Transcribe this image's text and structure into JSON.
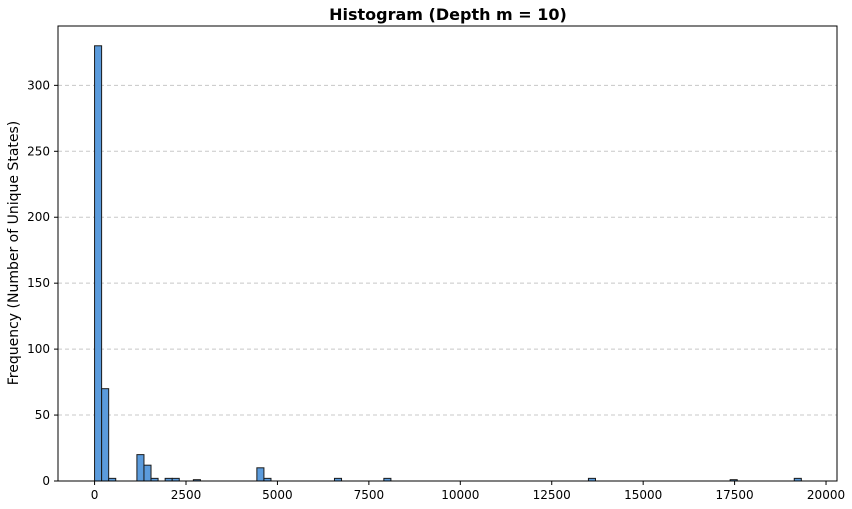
{
  "chart_data": {
    "type": "bar",
    "title": "Histogram  (Depth m = 10)",
    "xlabel": "",
    "ylabel": "Frequency (Number of Unique States)",
    "xlim": [
      -1000,
      20300
    ],
    "ylim": [
      0,
      345
    ],
    "bin_width": 193,
    "x_ticks": [
      0,
      2500,
      5000,
      7500,
      10000,
      12500,
      15000,
      17500,
      20000
    ],
    "y_ticks": [
      0,
      50,
      100,
      150,
      200,
      250,
      300
    ],
    "grid": "y dashed",
    "bar_color": "#5b9bdc",
    "edge_color": "#1a1a1a",
    "bins": [
      {
        "x": 96,
        "count": 330
      },
      {
        "x": 289,
        "count": 70
      },
      {
        "x": 482,
        "count": 2
      },
      {
        "x": 1254,
        "count": 20
      },
      {
        "x": 1447,
        "count": 12
      },
      {
        "x": 1640,
        "count": 2
      },
      {
        "x": 2026,
        "count": 2
      },
      {
        "x": 2219,
        "count": 2
      },
      {
        "x": 2798,
        "count": 1
      },
      {
        "x": 4534,
        "count": 10
      },
      {
        "x": 4727,
        "count": 2
      },
      {
        "x": 6656,
        "count": 2
      },
      {
        "x": 8006,
        "count": 2
      },
      {
        "x": 13600,
        "count": 2
      },
      {
        "x": 17475,
        "count": 1
      },
      {
        "x": 19228,
        "count": 2
      }
    ]
  }
}
